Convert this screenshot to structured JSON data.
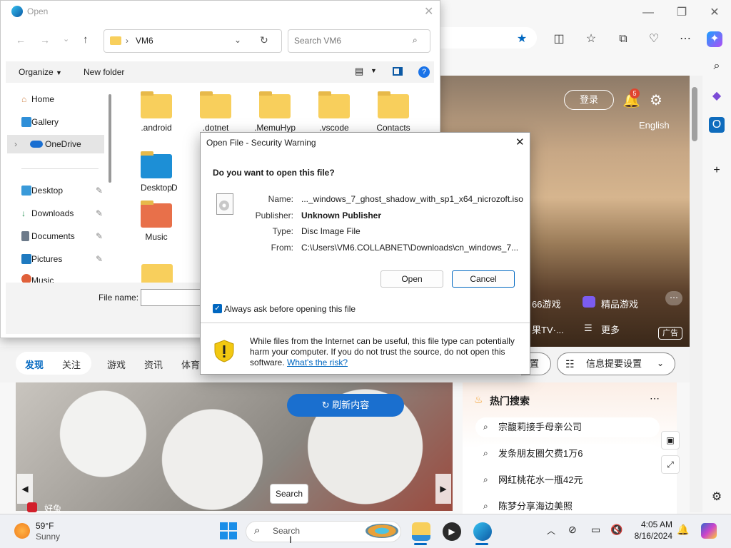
{
  "browser": {
    "hero": {
      "login": "登录",
      "notif_count": "5",
      "language": "English",
      "game1": "66游戏",
      "game2": "精品游戏",
      "tv": "果TV·...",
      "more": "更多",
      "ad": "广告"
    },
    "tabs": [
      "发现",
      "关注",
      "游戏",
      "资讯",
      "体育"
    ],
    "settings_btn": "置",
    "info_settings": "信息提要设置",
    "refresh": "刷新内容",
    "search_tip": "Search",
    "feed_caption": "好兔",
    "hot_title": "热门搜索",
    "hot_items": [
      "宗馥莉接手母亲公司",
      "发条朋友圈欠费1万6",
      "网红桃花水一瓶42元",
      "陈梦分享海边美照"
    ]
  },
  "explorer": {
    "title": "Open",
    "path": "VM6",
    "search_placeholder": "Search VM6",
    "organize": "Organize",
    "new_folder": "New folder",
    "nav": {
      "home": "Home",
      "gallery": "Gallery",
      "onedrive": "OneDrive",
      "desktop": "Desktop",
      "downloads": "Downloads",
      "documents": "Documents",
      "pictures": "Pictures",
      "music": "Music"
    },
    "items": [
      ".android",
      ".dotnet",
      ".MemuHyp",
      ".vscode",
      "Contacts",
      "Desktop",
      "D",
      "Music"
    ],
    "filename_label": "File name:"
  },
  "dialog": {
    "title": "Open File - Security Warning",
    "question": "Do you want to open this file?",
    "name_label": "Name:",
    "name": "..._windows_7_ghost_shadow_with_sp1_x64_nicrozoft.iso",
    "publisher_label": "Publisher:",
    "publisher": "Unknown Publisher",
    "type_label": "Type:",
    "type": "Disc Image File",
    "from_label": "From:",
    "from": "C:\\Users\\VM6.COLLABNET\\Downloads\\cn_windows_7...",
    "open": "Open",
    "cancel": "Cancel",
    "always_ask": "Always ask before opening this file",
    "warning": "While files from the Internet can be useful, this file type can potentially harm your computer. If you do not trust the source, do not open this software.",
    "risk_link": "What's the risk?"
  },
  "taskbar": {
    "temp": "59°F",
    "weather": "Sunny",
    "search": "Search",
    "time": "4:05 AM",
    "date": "8/16/2024"
  },
  "colors": {
    "accent": "#0067c0",
    "folder": "#f8cf5c",
    "refresh": "#1a6fcf"
  }
}
